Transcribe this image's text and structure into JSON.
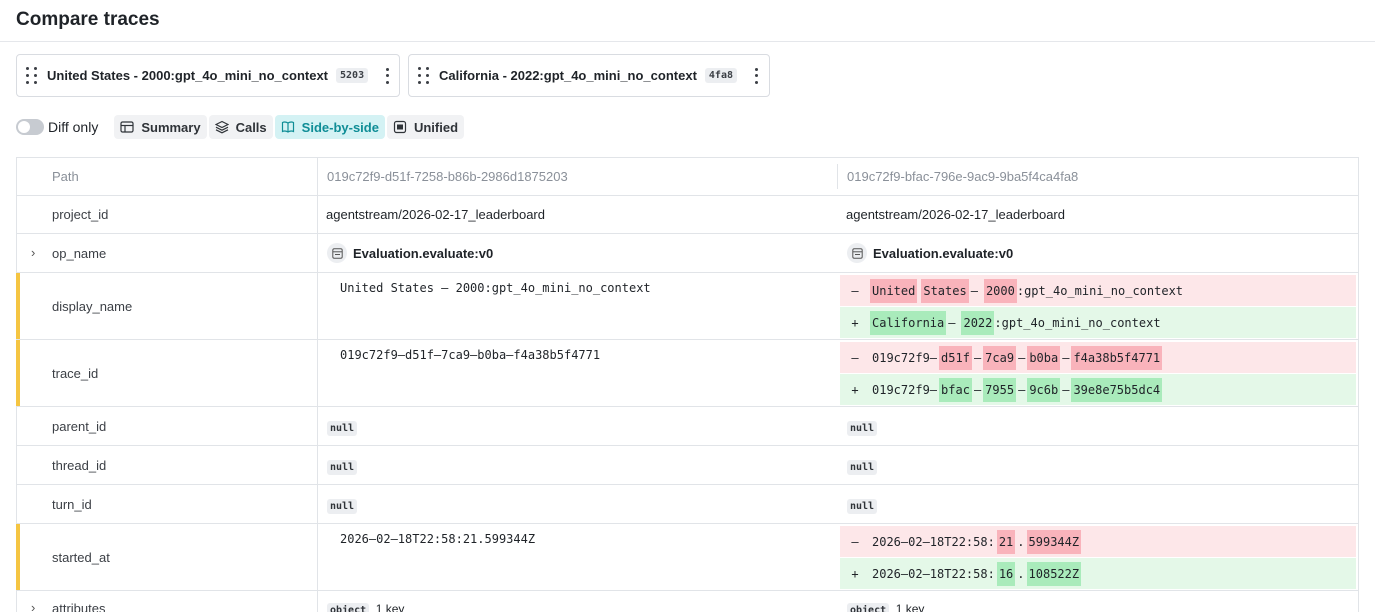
{
  "page": {
    "title": "Compare traces"
  },
  "traces": [
    {
      "title": "United States - 2000:gpt_4o_mini_no_context",
      "badge": "5203"
    },
    {
      "title": "California - 2022:gpt_4o_mini_no_context",
      "badge": "4fa8"
    }
  ],
  "toolbar": {
    "diff_only_label": "Diff only",
    "diff_only_on": false,
    "views": [
      {
        "label": "Summary",
        "icon": "table-icon",
        "active": false
      },
      {
        "label": "Calls",
        "icon": "layers-icon",
        "active": false
      },
      {
        "label": "Side-by-side",
        "icon": "book-open-icon",
        "active": true
      },
      {
        "label": "Unified",
        "icon": "document-icon",
        "active": false
      }
    ]
  },
  "table": {
    "header": {
      "path": "Path",
      "left_id": "019c72f9-d51f-7258-b86b-2986d1875203",
      "right_id": "019c72f9-bfac-796e-9ac9-9ba5f4ca4fa8"
    },
    "rows": {
      "project_id": {
        "label": "project_id",
        "left": "agentstream/2026-02-17_leaderboard",
        "right": "agentstream/2026-02-17_leaderboard"
      },
      "op_name": {
        "label": "op_name",
        "left": "Evaluation.evaluate:v0",
        "right": "Evaluation.evaluate:v0"
      },
      "display_name": {
        "label": "display_name",
        "left": "United States – 2000:gpt_4o_mini_no_context",
        "minus": [
          "United",
          "States",
          "–",
          "2000",
          ":gpt_4o_mini_no_context"
        ],
        "plus": [
          "California",
          "–",
          "2022",
          ":gpt_4o_mini_no_context"
        ]
      },
      "trace_id": {
        "label": "trace_id",
        "left": "019c72f9–d51f–7ca9–b0ba–f4a38b5f4771",
        "minus": [
          "019c72f9–",
          "d51f",
          "–",
          "7ca9",
          "–",
          "b0ba",
          "–",
          "f4a38b5f4771"
        ],
        "plus": [
          "019c72f9–",
          "bfac",
          "–",
          "7955",
          "–",
          "9c6b",
          "–",
          "39e8e75b5dc4"
        ]
      },
      "parent_id": {
        "label": "parent_id",
        "left": "null",
        "right": "null"
      },
      "thread_id": {
        "label": "thread_id",
        "left": "null",
        "right": "null"
      },
      "turn_id": {
        "label": "turn_id",
        "left": "null",
        "right": "null"
      },
      "started_at": {
        "label": "started_at",
        "left": "2026–02–18T22:58:21.599344Z",
        "minus": [
          "2026–02–18T22:58:",
          "21",
          ".",
          "599344Z"
        ],
        "plus": [
          "2026–02–18T22:58:",
          "16",
          ".",
          "108522Z"
        ]
      },
      "attributes": {
        "label": "attributes",
        "left_chip": "object",
        "left_text": "1 key",
        "right_chip": "object",
        "right_text": "1 key"
      }
    },
    "diff_signs": {
      "minus": "–",
      "plus": "+"
    }
  },
  "colors": {
    "accent": "#0f8d96",
    "changed_marker": "#f5c542",
    "del_bg": "#fde7e9",
    "del_hl": "#f9b3bb",
    "add_bg": "#e4f8e8",
    "add_hl": "#a9ebbb"
  }
}
